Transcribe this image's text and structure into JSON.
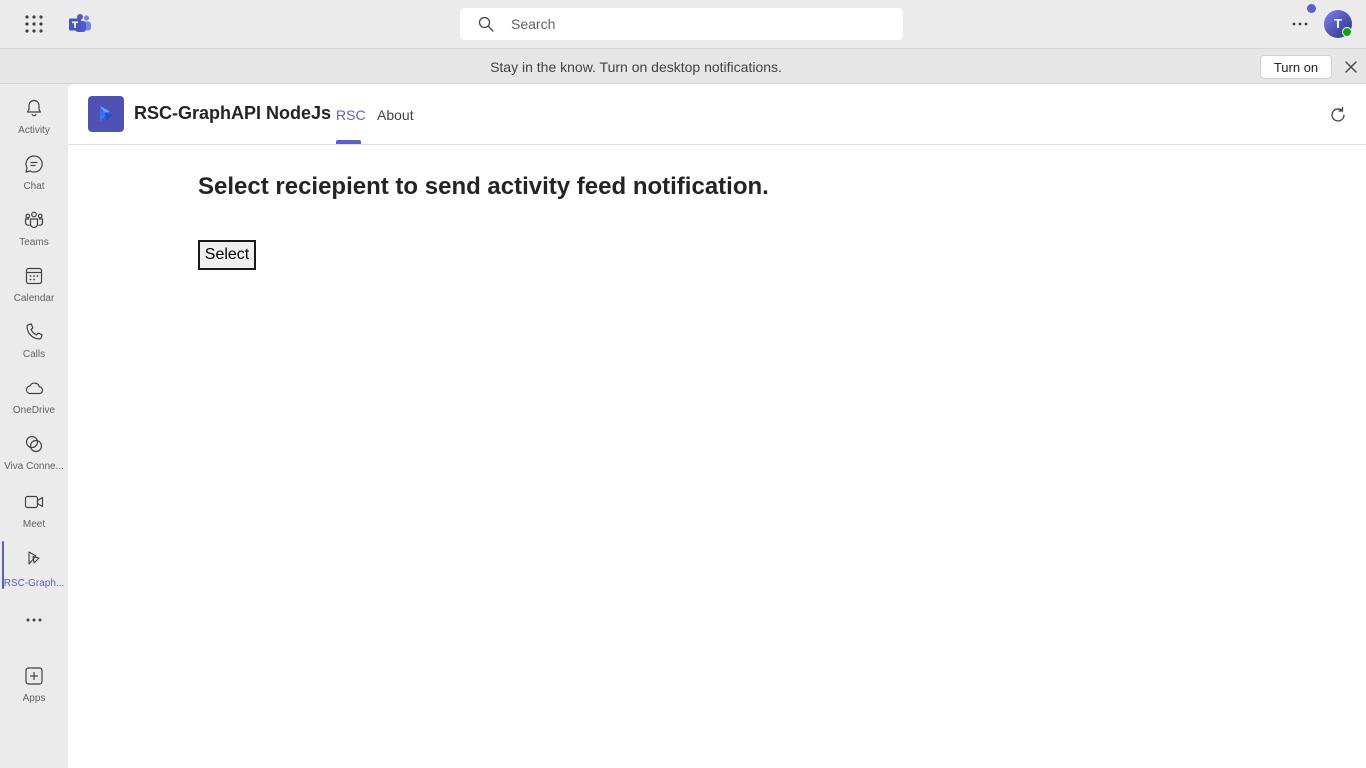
{
  "topbar": {
    "search_placeholder": "Search",
    "avatar_initial": "T"
  },
  "banner": {
    "message": "Stay in the know. Turn on desktop notifications.",
    "turn_on_label": "Turn on"
  },
  "rail": {
    "items": [
      {
        "label": "Activity",
        "icon": "bell-icon"
      },
      {
        "label": "Chat",
        "icon": "chat-icon"
      },
      {
        "label": "Teams",
        "icon": "teams-icon"
      },
      {
        "label": "Calendar",
        "icon": "calendar-icon"
      },
      {
        "label": "Calls",
        "icon": "phone-icon"
      },
      {
        "label": "OneDrive",
        "icon": "cloud-icon"
      },
      {
        "label": "Viva Conne...",
        "icon": "viva-connections-icon"
      },
      {
        "label": "Meet",
        "icon": "video-camera-icon"
      },
      {
        "label": "RSC-Graph...",
        "icon": "rsc-app-icon"
      },
      {
        "label": "",
        "icon": "more-apps-icon"
      },
      {
        "label": "Apps",
        "icon": "add-apps-icon"
      }
    ],
    "active_index": 8
  },
  "app": {
    "title": "RSC-GraphAPI NodeJs",
    "tabs": [
      "RSC",
      "About"
    ],
    "active_tab": "RSC"
  },
  "main": {
    "heading": "Select reciepient to send activity feed notification.",
    "select_button": "Select"
  },
  "colors": {
    "accent": "#5b5fc7",
    "chrome_bg": "#ebebeb",
    "content_bg": "#ffffff",
    "presence_available": "#13a10e"
  }
}
